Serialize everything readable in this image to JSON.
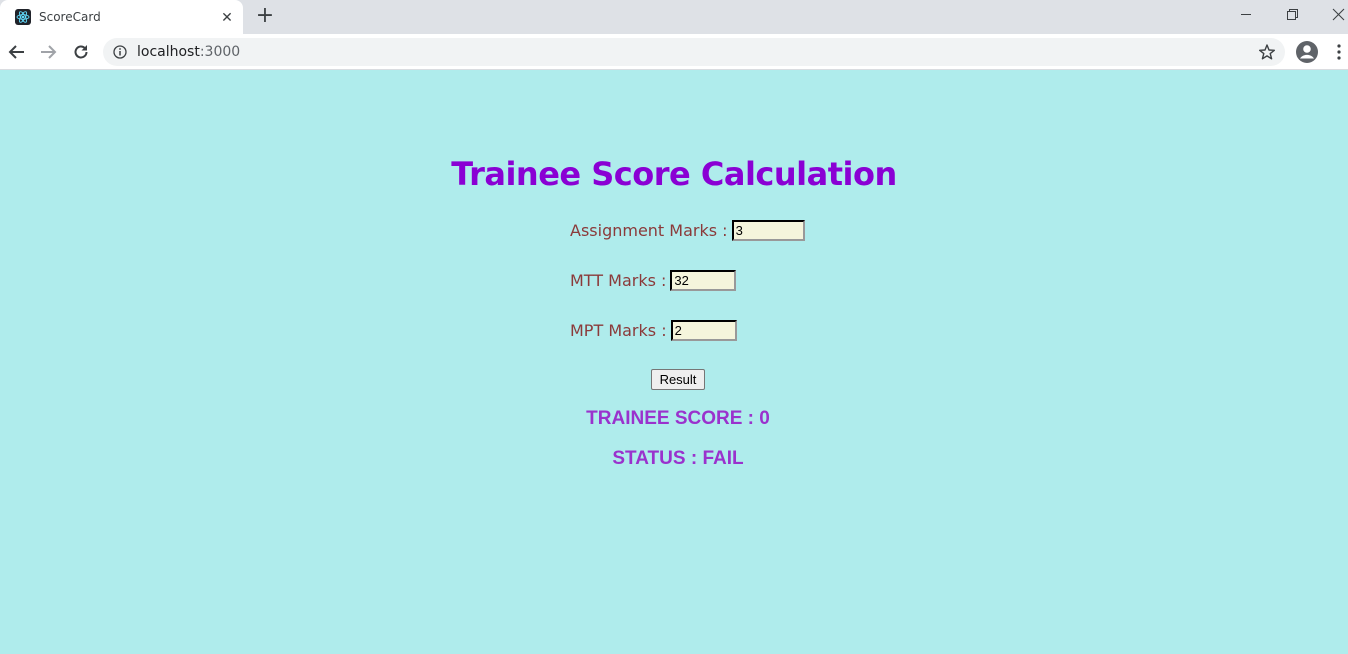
{
  "browser": {
    "tab_title": "ScoreCard",
    "tab_close": "✕",
    "new_tab": "+",
    "url_host": "localhost",
    "url_port": ":3000"
  },
  "page": {
    "title": "Trainee Score Calculation",
    "fields": [
      {
        "label": "Assignment Marks :",
        "value": "3"
      },
      {
        "label": "MTT Marks :",
        "value": "32"
      },
      {
        "label": "MPT Marks :",
        "value": "2"
      }
    ],
    "result_button": "Result",
    "score_text": "TRAINEE SCORE : 0",
    "status_text": "STATUS : FAIL"
  },
  "colors": {
    "page_bg": "#afecec",
    "title": "#8a00d4",
    "label": "#8b3a3a",
    "result_text": "#9a32cd",
    "input_bg": "#f5f5dc"
  },
  "icons": [
    "react-icon",
    "close-icon",
    "plus-icon",
    "minimize-icon",
    "restore-icon",
    "window-close-icon",
    "back-arrow-icon",
    "forward-arrow-icon",
    "reload-icon",
    "info-icon",
    "star-icon",
    "profile-icon",
    "kebab-menu-icon"
  ]
}
